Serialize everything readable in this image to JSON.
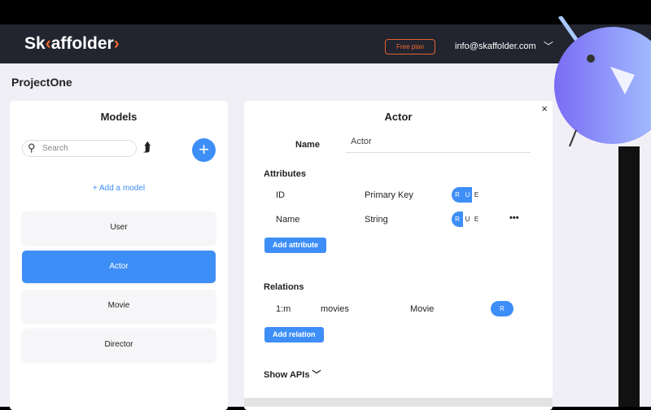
{
  "header": {
    "logo": "Skaffolder",
    "free_plan": "Free plan",
    "email": "info@skaffolder.com"
  },
  "project": "ProjectOne",
  "models": {
    "title": "Models",
    "search_placeholder": "Search",
    "add_model": "+ Add a model",
    "items": [
      "User",
      "Actor",
      "Movie",
      "Director"
    ],
    "selected": "Actor"
  },
  "detail": {
    "title": "Actor",
    "name_label": "Name",
    "name_value": "Actor",
    "attributes_label": "Attributes",
    "attributes": [
      {
        "name": "ID",
        "type": "Primary Key",
        "flags": [
          "R",
          "U",
          "E"
        ],
        "active": 2
      },
      {
        "name": "Name",
        "type": "String",
        "flags": [
          "R",
          "U",
          "E"
        ],
        "active": 1
      }
    ],
    "more": "•••",
    "add_attribute": "Add attribute",
    "relations_label": "Relations",
    "relations": [
      {
        "card": "1:m",
        "name": "movies",
        "model": "Movie",
        "flag": "R"
      }
    ],
    "add_relation": "Add relation",
    "show_apis": "Show APIs",
    "close": "×"
  },
  "colors": {
    "accent": "#3e8ef7",
    "brand": "#f26a2b"
  }
}
